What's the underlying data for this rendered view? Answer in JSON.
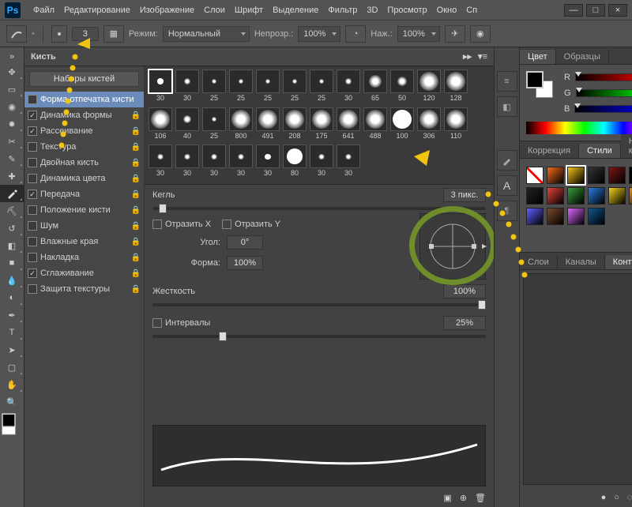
{
  "app": {
    "logo": "Ps"
  },
  "menu": [
    "Файл",
    "Редактирование",
    "Изображение",
    "Слои",
    "Шрифт",
    "Выделение",
    "Фильтр",
    "3D",
    "Просмотр",
    "Окно",
    "Сп"
  ],
  "optbar": {
    "brush_size": "3",
    "mode_label": "Режим:",
    "mode_value": "Нормальный",
    "opacity_label": "Непрозр.:",
    "opacity_value": "100%",
    "flow_label": "Наж.:",
    "flow_value": "100%"
  },
  "tools": [
    "move",
    "marquee",
    "lasso",
    "wand",
    "crop",
    "eyedrop",
    "heal",
    "brush",
    "stamp",
    "history",
    "eraser",
    "gradient",
    "blur",
    "dodge",
    "pen",
    "type",
    "arrow",
    "shape",
    "hand",
    "zoom"
  ],
  "brush_panel": {
    "title": "Кисть",
    "presets_btn": "Наборы кистей",
    "options": [
      {
        "label": "Форма отпечатка кисти",
        "checked": false,
        "sel": true,
        "lock": false
      },
      {
        "label": "Динамика формы",
        "checked": true,
        "lock": true
      },
      {
        "label": "Рассеивание",
        "checked": true,
        "lock": true
      },
      {
        "label": "Текстура",
        "checked": false,
        "lock": true
      },
      {
        "label": "Двойная кисть",
        "checked": false,
        "lock": true
      },
      {
        "label": "Динамика цвета",
        "checked": false,
        "lock": true
      },
      {
        "label": "Передача",
        "checked": true,
        "lock": true
      },
      {
        "label": "Положение кисти",
        "checked": false,
        "lock": true
      },
      {
        "label": "Шум",
        "checked": false,
        "lock": true
      },
      {
        "label": "Влажные края",
        "checked": false,
        "lock": true
      },
      {
        "label": "Накладка",
        "checked": false,
        "lock": true
      },
      {
        "label": "Сглаживание",
        "checked": true,
        "lock": true
      },
      {
        "label": "Защита текстуры",
        "checked": false,
        "lock": true
      }
    ],
    "thumbs": [
      {
        "n": "30",
        "t": "hard",
        "sel": true
      },
      {
        "n": "30",
        "t": "soft"
      },
      {
        "n": "25",
        "t": "soft"
      },
      {
        "n": "25",
        "t": "soft"
      },
      {
        "n": "25",
        "t": "soft"
      },
      {
        "n": "25",
        "t": "soft"
      },
      {
        "n": "25",
        "t": "soft"
      },
      {
        "n": "30",
        "t": "soft"
      },
      {
        "n": "65",
        "t": "soft"
      },
      {
        "n": "50",
        "t": "soft"
      },
      {
        "n": "120",
        "t": "soft"
      },
      {
        "n": "128",
        "t": "soft"
      },
      {
        "n": "106",
        "t": "soft"
      },
      {
        "n": "40",
        "t": "soft"
      },
      {
        "n": "25",
        "t": "soft"
      },
      {
        "n": "800",
        "t": "soft"
      },
      {
        "n": "491",
        "t": "soft"
      },
      {
        "n": "208",
        "t": "soft"
      },
      {
        "n": "175",
        "t": "soft"
      },
      {
        "n": "641",
        "t": "soft"
      },
      {
        "n": "488",
        "t": "soft"
      },
      {
        "n": "100",
        "t": "hard"
      },
      {
        "n": "306",
        "t": "soft"
      },
      {
        "n": "110",
        "t": "soft"
      },
      {
        "n": "30",
        "t": "soft"
      },
      {
        "n": "30",
        "t": "soft"
      },
      {
        "n": "30",
        "t": "soft"
      },
      {
        "n": "30",
        "t": "soft"
      },
      {
        "n": "30",
        "t": "hard"
      },
      {
        "n": "80",
        "t": "hard"
      },
      {
        "n": "30",
        "t": "soft"
      },
      {
        "n": "30",
        "t": "soft"
      }
    ],
    "size_label": "Кегль",
    "size_value": "3 пикс.",
    "flipx": "Отразить X",
    "flipy": "Отразить Y",
    "angle_label": "Угол:",
    "angle_value": "0°",
    "round_label": "Форма:",
    "round_value": "100%",
    "hardness_label": "Жесткость",
    "hardness_value": "100%",
    "spacing_label": "Интервалы",
    "spacing_value": "25%"
  },
  "right": {
    "color_tab": "Цвет",
    "swatches_tab": "Образцы",
    "r": "R",
    "g": "G",
    "b": "B",
    "rv": "0",
    "gv": "0",
    "bv": "0",
    "corr_tab": "Коррекция",
    "styles_tab": "Стили",
    "preset_tab": "Наборы кистей",
    "layers_tab": "Слои",
    "channels_tab": "Каналы",
    "paths_tab": "Контуры",
    "style_colors": [
      "#ffffff00",
      "#f46b1b",
      "#f4c21b",
      "#333333",
      "#7a1616",
      "#000",
      "#b0b0b0",
      "#222",
      "#e7443a",
      "#3a9c3d",
      "#2a7de1",
      "#f2d21c",
      "#ec8d1c",
      "#5fc5f0",
      "#6060ff",
      "#7a4a2a",
      "#d968ff",
      "#115890"
    ]
  }
}
